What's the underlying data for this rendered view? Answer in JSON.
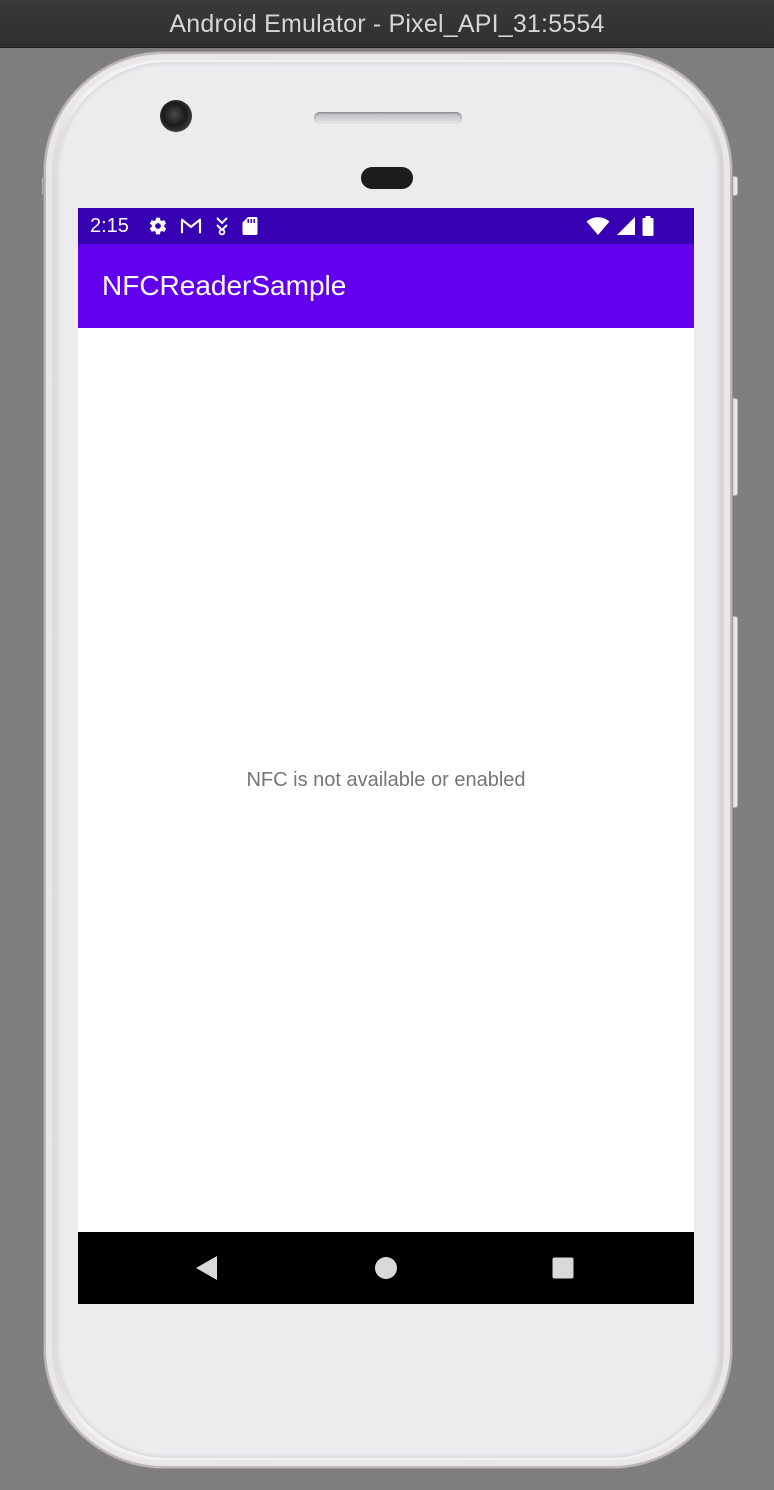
{
  "window": {
    "title": "Android Emulator - Pixel_API_31:5554"
  },
  "status_bar": {
    "time": "2:15",
    "left_icons": [
      "settings-icon",
      "gmail-icon",
      "download-icon",
      "sd-card-icon"
    ],
    "right_icons": [
      "wifi-icon",
      "cell-signal-icon",
      "battery-icon"
    ],
    "color": "#3700b3"
  },
  "app_bar": {
    "title": "NFCReaderSample",
    "color": "#6200ee"
  },
  "content": {
    "message": "NFC is not available or enabled"
  },
  "nav_bar": {
    "buttons": [
      "back-icon",
      "home-icon",
      "recents-icon"
    ]
  }
}
